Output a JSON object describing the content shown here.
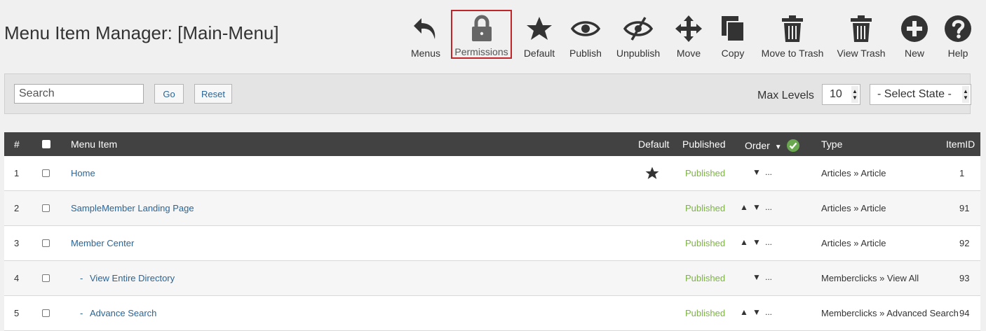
{
  "page": {
    "title": "Menu Item Manager: [Main-Menu]"
  },
  "toolbar": [
    {
      "key": "menus",
      "label": "Menus",
      "icon": "reply-arrow-icon"
    },
    {
      "key": "permissions",
      "label": "Permissions",
      "icon": "lock-icon",
      "selected": true
    },
    {
      "key": "default",
      "label": "Default",
      "icon": "star-icon"
    },
    {
      "key": "publish",
      "label": "Publish",
      "icon": "eye-icon"
    },
    {
      "key": "unpublish",
      "label": "Unpublish",
      "icon": "eye-slash-icon"
    },
    {
      "key": "move",
      "label": "Move",
      "icon": "move-arrows-icon"
    },
    {
      "key": "copy",
      "label": "Copy",
      "icon": "copy-icon"
    },
    {
      "key": "move_to_trash",
      "label": "Move to Trash",
      "icon": "trash-icon"
    },
    {
      "key": "view_trash",
      "label": "View Trash",
      "icon": "trash-icon"
    },
    {
      "key": "new",
      "label": "New",
      "icon": "plus-circle-icon"
    },
    {
      "key": "help",
      "label": "Help",
      "icon": "question-circle-icon"
    }
  ],
  "filters": {
    "search_placeholder": "Search",
    "go_label": "Go",
    "reset_label": "Reset",
    "max_levels_label": "Max Levels",
    "max_levels_value": "10",
    "state_value": "- Select State -"
  },
  "table": {
    "headers": {
      "num": "#",
      "menu_item": "Menu Item",
      "default": "Default",
      "published": "Published",
      "order": "Order",
      "type": "Type",
      "item_id": "ItemID"
    },
    "rows": [
      {
        "num": "1",
        "title": "Home",
        "prefix": "",
        "is_default": true,
        "published": "Published",
        "up": false,
        "down": true,
        "ellipsis": "...",
        "type": "Articles » Article",
        "id": "1"
      },
      {
        "num": "2",
        "title": "SampleMember Landing Page",
        "prefix": "",
        "is_default": false,
        "published": "Published",
        "up": true,
        "down": true,
        "ellipsis": "...",
        "type": "Articles » Article",
        "id": "91"
      },
      {
        "num": "3",
        "title": "Member Center",
        "prefix": "",
        "is_default": false,
        "published": "Published",
        "up": true,
        "down": true,
        "ellipsis": "...",
        "type": "Articles » Article",
        "id": "92"
      },
      {
        "num": "4",
        "title": "View Entire Directory",
        "prefix": "-",
        "is_default": false,
        "published": "Published",
        "up": false,
        "down": true,
        "ellipsis": "...",
        "type": "Memberclicks » View All",
        "id": "93"
      },
      {
        "num": "5",
        "title": "Advance Search",
        "prefix": "-",
        "is_default": false,
        "published": "Published",
        "up": true,
        "down": true,
        "ellipsis": "...",
        "type": "Memberclicks » Advanced Search",
        "id": "94"
      }
    ]
  },
  "colors": {
    "accent_link": "#2a6496",
    "published": "#7cb342",
    "selected_border": "#c0252a",
    "header_bg": "#424242",
    "order_check": "#6aa84f"
  }
}
